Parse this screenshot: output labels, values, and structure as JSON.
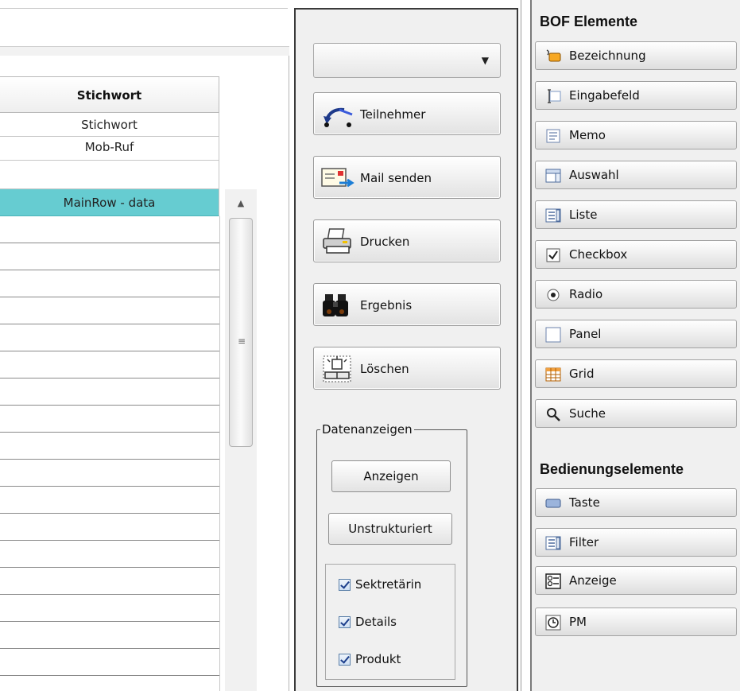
{
  "grid": {
    "column_header": "Stichwort",
    "rows": [
      "Stichwort",
      "Mob-Ruf",
      ""
    ],
    "selected_row": "MainRow - data"
  },
  "actions": {
    "dropdown_value": "",
    "buttons": [
      {
        "label": "Teilnehmer",
        "icon": "teilnehmer-icon"
      },
      {
        "label": "Mail senden",
        "icon": "mail-send-icon"
      },
      {
        "label": "Drucken",
        "icon": "printer-icon"
      },
      {
        "label": "Ergebnis",
        "icon": "binoculars-icon"
      },
      {
        "label": "Löschen",
        "icon": "delete-icon"
      }
    ]
  },
  "data_display": {
    "legend": "Datenanzeigen",
    "show_button": "Anzeigen",
    "unstructured_button": "Unstrukturiert",
    "checkboxes": [
      {
        "label": "Sektretärin",
        "checked": true
      },
      {
        "label": "Details",
        "checked": true
      },
      {
        "label": "Produkt",
        "checked": true
      }
    ]
  },
  "toolbox": {
    "bof_title": "BOF Elemente",
    "bof_items": [
      {
        "label": "Bezeichnung",
        "icon": "label-icon"
      },
      {
        "label": "Eingabefeld",
        "icon": "textfield-icon"
      },
      {
        "label": "Memo",
        "icon": "memo-icon"
      },
      {
        "label": "Auswahl",
        "icon": "combobox-icon"
      },
      {
        "label": "Liste",
        "icon": "listbox-icon"
      },
      {
        "label": "Checkbox",
        "icon": "checkbox-icon"
      },
      {
        "label": "Radio",
        "icon": "radio-icon"
      },
      {
        "label": "Panel",
        "icon": "panel-icon"
      },
      {
        "label": "Grid",
        "icon": "grid-icon"
      },
      {
        "label": "Suche",
        "icon": "search-icon"
      }
    ],
    "controls_title": "Bedienungselemente",
    "control_items": [
      {
        "label": "Taste",
        "icon": "button-icon"
      },
      {
        "label": "Filter",
        "icon": "filter-icon"
      },
      {
        "label": "Anzeige",
        "icon": "display-icon"
      },
      {
        "label": "PM",
        "icon": "clock-icon"
      }
    ]
  },
  "colors": {
    "selected_row": "#66ccd1",
    "panel_background": "#f0f0f0",
    "checkbox_check": "#1d3f8c"
  }
}
